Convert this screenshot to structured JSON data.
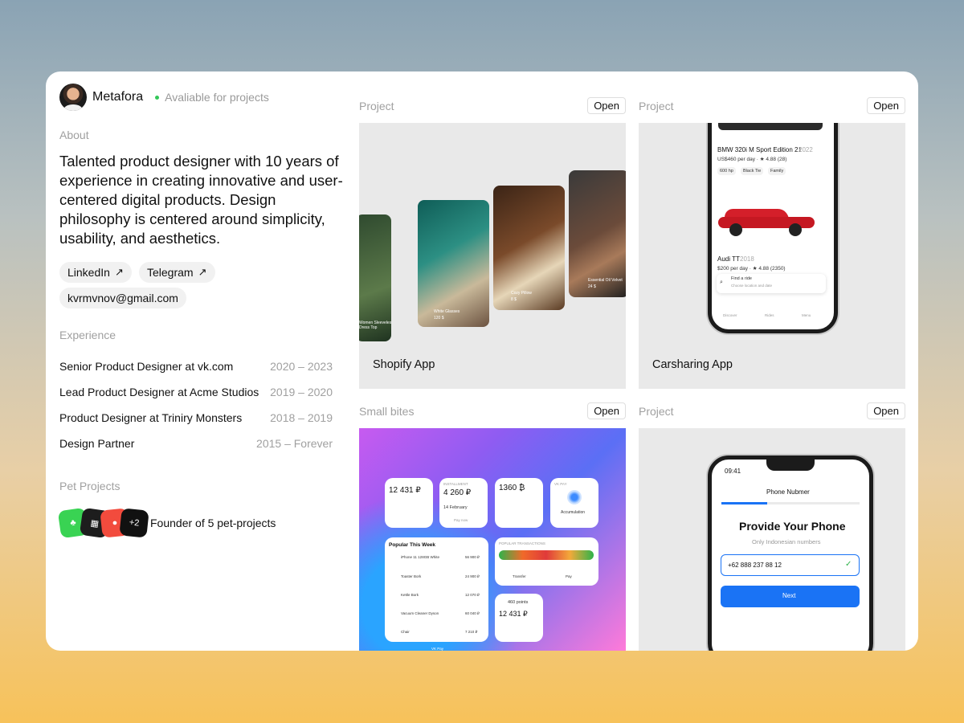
{
  "profile": {
    "name": "Metafora",
    "status": "Avaliable for projects"
  },
  "about": {
    "label": "About",
    "text": "Talented product designer with 10 years of experience in creating innovative and user-centered digital products. Design philosophy is centered around simplicity, usability, and aesthetics."
  },
  "links": {
    "linkedin": "LinkedIn",
    "telegram": "Telegram",
    "email": "kvrmvnov@gmail.com"
  },
  "experience": {
    "label": "Experience",
    "items": [
      {
        "role": "Senior Product Designer at vk.com",
        "years": "2020 – 2023"
      },
      {
        "role": "Lead Product Designer at Acme Studios",
        "years": "2019 – 2020"
      },
      {
        "role": "Product Designer at Triniry Monsters",
        "years": "2018 – 2019"
      },
      {
        "role": "Design Partner",
        "years": "2015 – Forever"
      }
    ]
  },
  "pets": {
    "label": "Pet Projects",
    "more": "+2",
    "text": "Founder of 5 pet-projects"
  },
  "projects": [
    {
      "label": "Project",
      "open": "Open",
      "title": "Shopify App"
    },
    {
      "label": "Project",
      "open": "Open",
      "title": "Carsharing App"
    },
    {
      "label": "Small bites",
      "open": "Open",
      "title": ""
    },
    {
      "label": "Project",
      "open": "Open",
      "title": ""
    }
  ],
  "shopify_cards": [
    {
      "caption": "Women Sleeveless Piper Dress Top",
      "price": "16 $"
    },
    {
      "caption": "White Glasses",
      "price": "120 $"
    },
    {
      "caption": "Cozy Pillow",
      "price": "8 $"
    },
    {
      "caption": "Essential Oil Velvet",
      "price": "24 $"
    }
  ],
  "car_app": {
    "car1": "BMW 320i M Sport Edition 21",
    "car1_year": "2022",
    "car1_price": "US$460 per day · ★ 4.88 (28)",
    "tags": [
      "600 hp",
      "Black Tie",
      "Family"
    ],
    "car2": "Audi TT",
    "car2_year": "2018",
    "car2_price": "$200 per day · ★ 4.88 (2350)",
    "search": "Find a ride",
    "search_sub": "Choose location and date",
    "nav": [
      "Discover",
      "Rides",
      "Menu"
    ]
  },
  "vk_widgets": {
    "w1_amount": "12 431 ₽",
    "w2_label": "INSTALLMENT",
    "w2_amount": "4 260 ₽",
    "w2_date": "14 February",
    "w2_pay": "Pay now",
    "w3_amount": "1360 ₿",
    "w4_label": "VK PAY",
    "w4_text": "Accumulation",
    "popular_title": "Popular This Week",
    "popular": [
      {
        "name": "iPhone 11 128GB White",
        "price": "56 900 ₽"
      },
      {
        "name": "Toaster Bork",
        "price": "24 900 ₽"
      },
      {
        "name": "Kettle Bork",
        "price": "12 070 ₽"
      },
      {
        "name": "Vacuum Cleaner Dyson",
        "price": "60 040 ₽"
      },
      {
        "name": "Chair",
        "price": "7 210 ₽"
      }
    ],
    "transactions_title": "POPULAR TRANSACTIONS",
    "transfer": "Transfer",
    "pay": "Pay",
    "points": "460 points",
    "points_amount": "12 431 ₽",
    "footer": "VK Pay"
  },
  "phone_app": {
    "time": "09:41",
    "header": "Phone Nubmer",
    "title": "Provide Your Phone",
    "subtitle": "Only Indonesian numbers",
    "value": "+62 888 237 88 12",
    "next": "Next"
  },
  "colors": {
    "available": "#34c759",
    "primary_blue": "#1a73f5"
  }
}
